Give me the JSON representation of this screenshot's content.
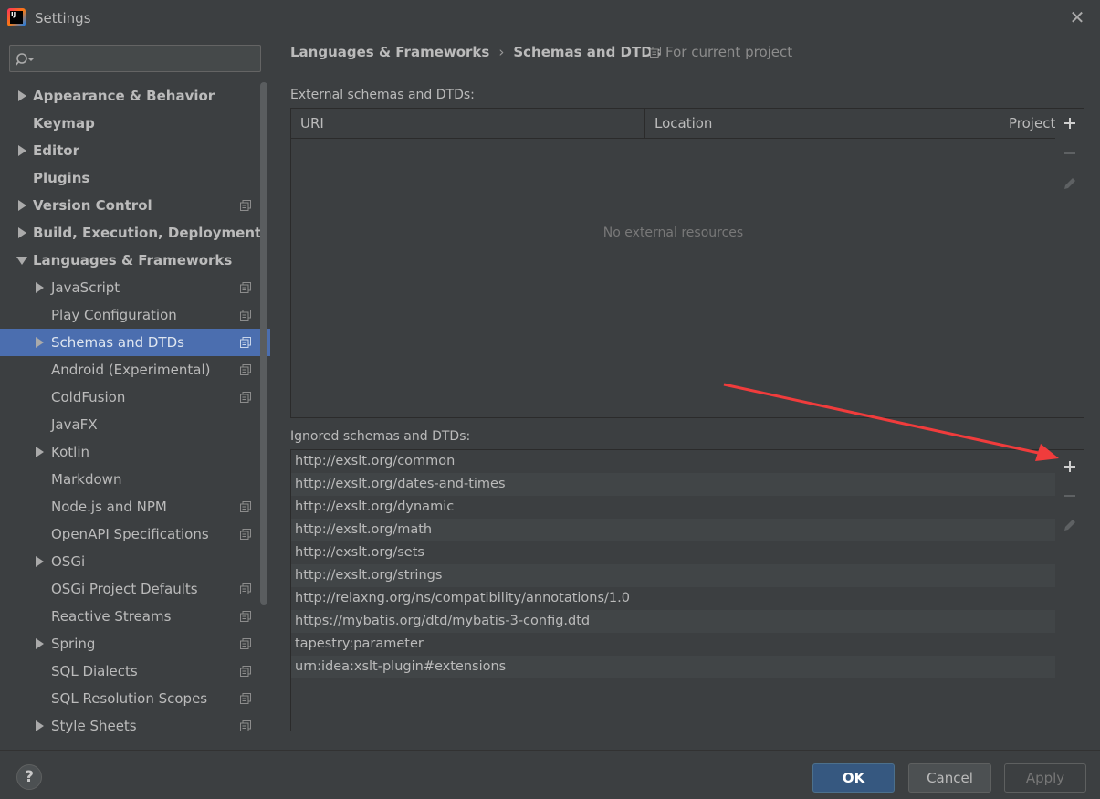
{
  "window": {
    "title": "Settings",
    "logo_text": "IJ"
  },
  "search": {
    "placeholder": "",
    "value": ""
  },
  "sidebar": {
    "items": [
      {
        "label": "Appearance & Behavior",
        "level": 0,
        "bold": true,
        "arrow": "right",
        "project": false
      },
      {
        "label": "Keymap",
        "level": 0,
        "bold": true,
        "arrow": "",
        "project": false
      },
      {
        "label": "Editor",
        "level": 0,
        "bold": true,
        "arrow": "right",
        "project": false
      },
      {
        "label": "Plugins",
        "level": 0,
        "bold": true,
        "arrow": "",
        "project": false
      },
      {
        "label": "Version Control",
        "level": 0,
        "bold": true,
        "arrow": "right",
        "project": true
      },
      {
        "label": "Build, Execution, Deployment",
        "level": 0,
        "bold": true,
        "arrow": "right",
        "project": false
      },
      {
        "label": "Languages & Frameworks",
        "level": 0,
        "bold": true,
        "arrow": "down",
        "project": false
      },
      {
        "label": "JavaScript",
        "level": 1,
        "bold": false,
        "arrow": "right",
        "project": true
      },
      {
        "label": "Play Configuration",
        "level": 1,
        "bold": false,
        "arrow": "",
        "project": true
      },
      {
        "label": "Schemas and DTDs",
        "level": 1,
        "bold": false,
        "arrow": "right",
        "project": true,
        "selected": true
      },
      {
        "label": "Android (Experimental)",
        "level": 1,
        "bold": false,
        "arrow": "",
        "project": true
      },
      {
        "label": "ColdFusion",
        "level": 1,
        "bold": false,
        "arrow": "",
        "project": true
      },
      {
        "label": "JavaFX",
        "level": 1,
        "bold": false,
        "arrow": "",
        "project": false
      },
      {
        "label": "Kotlin",
        "level": 1,
        "bold": false,
        "arrow": "right",
        "project": false
      },
      {
        "label": "Markdown",
        "level": 1,
        "bold": false,
        "arrow": "",
        "project": false
      },
      {
        "label": "Node.js and NPM",
        "level": 1,
        "bold": false,
        "arrow": "",
        "project": true
      },
      {
        "label": "OpenAPI Specifications",
        "level": 1,
        "bold": false,
        "arrow": "",
        "project": true
      },
      {
        "label": "OSGi",
        "level": 1,
        "bold": false,
        "arrow": "right",
        "project": false
      },
      {
        "label": "OSGi Project Defaults",
        "level": 1,
        "bold": false,
        "arrow": "",
        "project": true
      },
      {
        "label": "Reactive Streams",
        "level": 1,
        "bold": false,
        "arrow": "",
        "project": true
      },
      {
        "label": "Spring",
        "level": 1,
        "bold": false,
        "arrow": "right",
        "project": true
      },
      {
        "label": "SQL Dialects",
        "level": 1,
        "bold": false,
        "arrow": "",
        "project": true
      },
      {
        "label": "SQL Resolution Scopes",
        "level": 1,
        "bold": false,
        "arrow": "",
        "project": true
      },
      {
        "label": "Style Sheets",
        "level": 1,
        "bold": false,
        "arrow": "right",
        "project": true
      }
    ]
  },
  "breadcrumb": {
    "parent": "Languages & Frameworks",
    "separator": "›",
    "current": "Schemas and DTDs",
    "scope": "For current project"
  },
  "external": {
    "label": "External schemas and DTDs:",
    "columns": [
      "URI",
      "Location",
      "Project"
    ],
    "empty_text": "No external resources"
  },
  "ignored": {
    "label": "Ignored schemas and DTDs:",
    "rows": [
      "http://exslt.org/common",
      "http://exslt.org/dates-and-times",
      "http://exslt.org/dynamic",
      "http://exslt.org/math",
      "http://exslt.org/sets",
      "http://exslt.org/strings",
      "http://relaxng.org/ns/compatibility/annotations/1.0",
      "https://mybatis.org/dtd/mybatis-3-config.dtd",
      "tapestry:parameter",
      "urn:idea:xslt-plugin#extensions"
    ]
  },
  "footer": {
    "help_label": "?",
    "ok_label": "OK",
    "cancel_label": "Cancel",
    "apply_label": "Apply"
  },
  "colors": {
    "selection": "#4b6eaf",
    "annotation_arrow": "#f03c3c",
    "ok_button": "#365880"
  }
}
